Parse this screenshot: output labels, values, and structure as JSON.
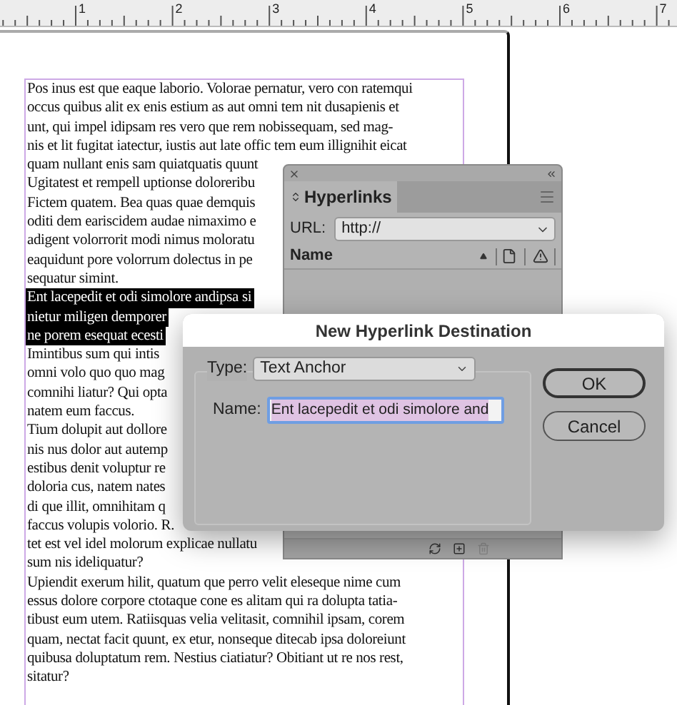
{
  "ruler": {
    "numbers": [
      "1",
      "2",
      "3",
      "4",
      "5",
      "6",
      "7"
    ]
  },
  "document": {
    "lines": [
      {
        "text": "Pos inus est que eaque laborio. Volorae pernatur, vero con ratemqui",
        "selected": false
      },
      {
        "text": "occus quibus alit ex enis estium as aut omni tem nit dusapienis et",
        "selected": false
      },
      {
        "text": "unt, qui impel idipsam res vero que rem nobissequam, sed mag-",
        "selected": false
      },
      {
        "text": "nis et lit fugitat iatectur, iustis aut late offic tem eum illignihit eicat",
        "selected": false
      },
      {
        "text": "quam nullant enis sam quiatquatis quunt",
        "selected": false
      },
      {
        "text": "Ugitatest et rempell uptionse doloreribu",
        "selected": false
      },
      {
        "text": "Fictem quatem. Bea quas quae demquis",
        "selected": false
      },
      {
        "text": "oditi dem eariscidem audae nimaximo e",
        "selected": false
      },
      {
        "text": "adigent volorrorit modi nimus moloratu",
        "selected": false
      },
      {
        "text": "eaquidunt pore volorrum dolectus in pe",
        "selected": false
      },
      {
        "text": "sequatur simint.",
        "selected": false
      },
      {
        "text": "Ent lacepedit et odi simolore andipsa si",
        "selected": true
      },
      {
        "text": "nietur miligen demporer",
        "selected": true
      },
      {
        "text": "ne porem esequat ecesti",
        "selected": true
      },
      {
        "text": "Imintibus sum qui intis",
        "selected": false
      },
      {
        "text": "omni volo quo quo mag",
        "selected": false
      },
      {
        "text": "comnihi liatur? Qui opta",
        "selected": false
      },
      {
        "text": "natem eum faccus.",
        "selected": false
      },
      {
        "text": "Tium dolupit aut dollore",
        "selected": false
      },
      {
        "text": "nis nus dolor aut autemp",
        "selected": false
      },
      {
        "text": "estibus denit voluptur re",
        "selected": false
      },
      {
        "text": "doloria cus, natem nates",
        "selected": false
      },
      {
        "text": "di que illit, omnihitam q",
        "selected": false
      },
      {
        "text": "faccus volupis volorio. R.",
        "selected": false
      },
      {
        "text": "tet est vel idel molorum explicae nullatu",
        "selected": false
      },
      {
        "text": "sum nis ideliquatur?",
        "selected": false
      },
      {
        "text": "Upiendit exerum hilit, quatum que perro velit eleseque nime cum",
        "selected": false
      },
      {
        "text": "essus dolore corpore ctotaque cone es alitam qui ra dolupta tatia-",
        "selected": false
      },
      {
        "text": "tibust eum utem. Ratiisquas velia velitasit, comnihil ipsam, corem",
        "selected": false
      },
      {
        "text": "quam, nectat facit quunt, ex etur, nonseque ditecab ipsa doloreiunt",
        "selected": false
      },
      {
        "text": "quibusa doluptatum rem. Nestius ciatiatur? Obitiant ut re nos rest,",
        "selected": false
      },
      {
        "text": "sitatur?",
        "selected": false
      }
    ]
  },
  "hyperlinks_panel": {
    "tab": "Hyperlinks",
    "url_label": "URL:",
    "url_value": "http://",
    "column": "Name"
  },
  "dialog": {
    "title": "New Hyperlink Destination",
    "type_label": "Type:",
    "type_value": "Text Anchor",
    "name_label": "Name:",
    "name_value": "Ent lacepedit et odi simolore and",
    "buttons": [
      {
        "label": "OK",
        "default": true
      },
      {
        "label": "Cancel",
        "default": false
      }
    ]
  }
}
